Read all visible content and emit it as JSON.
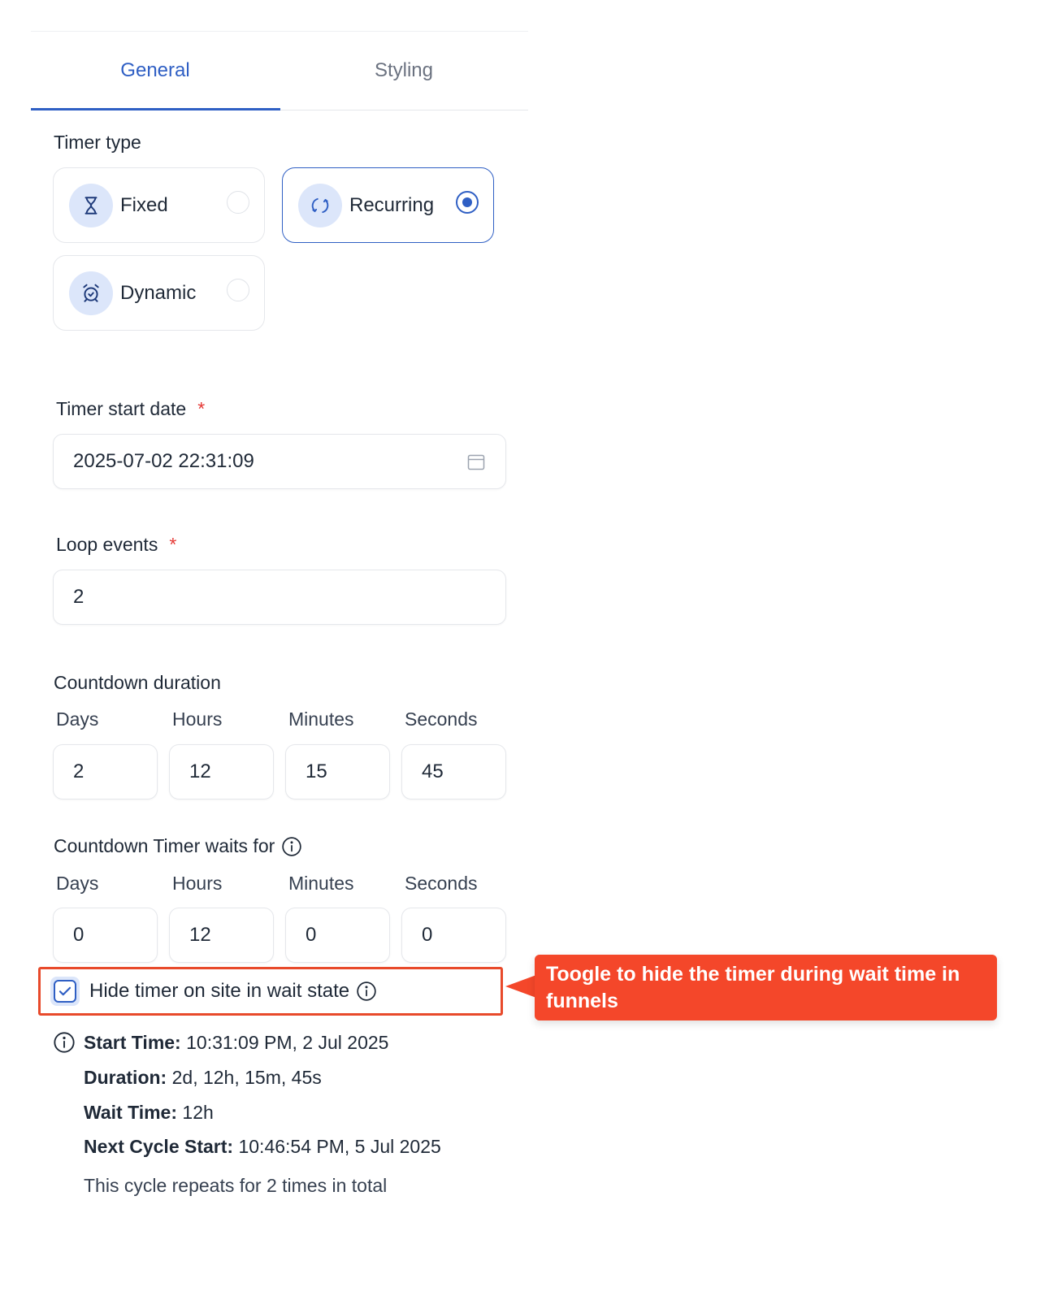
{
  "tabs": [
    {
      "label": "General",
      "active": true
    },
    {
      "label": "Styling",
      "active": false
    }
  ],
  "timer_type": {
    "label": "Timer type",
    "options": [
      {
        "label": "Fixed",
        "icon": "hourglass-icon",
        "selected": false
      },
      {
        "label": "Recurring",
        "icon": "refresh-cycle-icon",
        "selected": true
      },
      {
        "label": "Dynamic",
        "icon": "alarm-clock-icon",
        "selected": false
      }
    ]
  },
  "start_date": {
    "label": "Timer start date",
    "required_mark": "*",
    "value": "2025-07-02 22:31:09",
    "icon": "calendar-icon"
  },
  "loop_events": {
    "label": "Loop events",
    "required_mark": "*",
    "value": "2"
  },
  "countdown_duration": {
    "label": "Countdown duration",
    "columns": [
      "Days",
      "Hours",
      "Minutes",
      "Seconds"
    ],
    "values": [
      "2",
      "12",
      "15",
      "45"
    ]
  },
  "wait_for": {
    "label": "Countdown Timer waits for",
    "icon": "info-icon",
    "columns": [
      "Days",
      "Hours",
      "Minutes",
      "Seconds"
    ],
    "values": [
      "0",
      "12",
      "0",
      "0"
    ]
  },
  "hide_timer": {
    "label": "Hide timer on site in wait state",
    "checked": true,
    "icon": "info-icon"
  },
  "callout": {
    "text": "Toogle to hide the timer during wait time in funnels"
  },
  "summary": {
    "icon": "info-icon",
    "start_time_label": "Start Time:",
    "start_time_value": "10:31:09 PM, 2 Jul 2025",
    "duration_label": "Duration:",
    "duration_value": "2d, 12h, 15m, 45s",
    "wait_time_label": "Wait Time:",
    "wait_time_value": "12h",
    "next_cycle_label": "Next Cycle Start:",
    "next_cycle_value": "10:46:54 PM, 5 Jul 2025",
    "repeat_text": "This cycle repeats for 2 times in total"
  },
  "colors": {
    "accent": "#2f5fc4",
    "icon_bg": "#dce6fa",
    "callout": "#f4472a",
    "highlight_border": "#e84a2b",
    "required": "#e53935"
  }
}
